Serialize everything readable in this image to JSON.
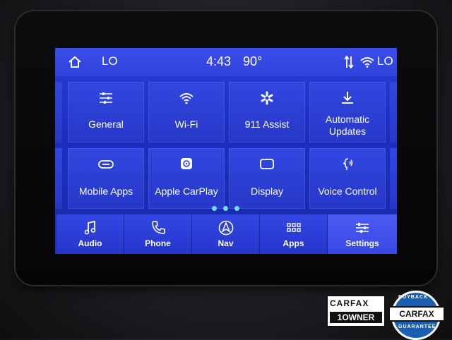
{
  "status_bar": {
    "left_label": "LO",
    "time": "4:43",
    "temperature": "90°",
    "right_label": "LO"
  },
  "tiles": [
    {
      "label": "General",
      "icon": "sliders-icon"
    },
    {
      "label": "Wi-Fi",
      "icon": "wifi-icon"
    },
    {
      "label": "911 Assist",
      "icon": "asterisk-icon"
    },
    {
      "label": "Automatic Updates",
      "icon": "download-icon"
    },
    {
      "label": "Mobile Apps",
      "icon": "link-icon"
    },
    {
      "label": "Apple CarPlay",
      "icon": "carplay-icon"
    },
    {
      "label": "Display",
      "icon": "display-icon"
    },
    {
      "label": "Voice Control",
      "icon": "voice-icon"
    }
  ],
  "page_indicator": {
    "count": 3,
    "active": 0
  },
  "nav": [
    {
      "label": "Audio",
      "icon": "music-note-icon"
    },
    {
      "label": "Phone",
      "icon": "phone-icon"
    },
    {
      "label": "Nav",
      "icon": "navigation-icon"
    },
    {
      "label": "Apps",
      "icon": "apps-grid-icon"
    },
    {
      "label": "Settings",
      "icon": "settings-sliders-icon",
      "active": true
    }
  ],
  "badges": {
    "carfax_one_owner": {
      "top": "CARFAX",
      "bottom": "1OWNER"
    },
    "carfax_buyback": {
      "word": "CARFAX",
      "ring_top": "BUYBACK",
      "ring_bottom": "GUARANTEE"
    }
  }
}
